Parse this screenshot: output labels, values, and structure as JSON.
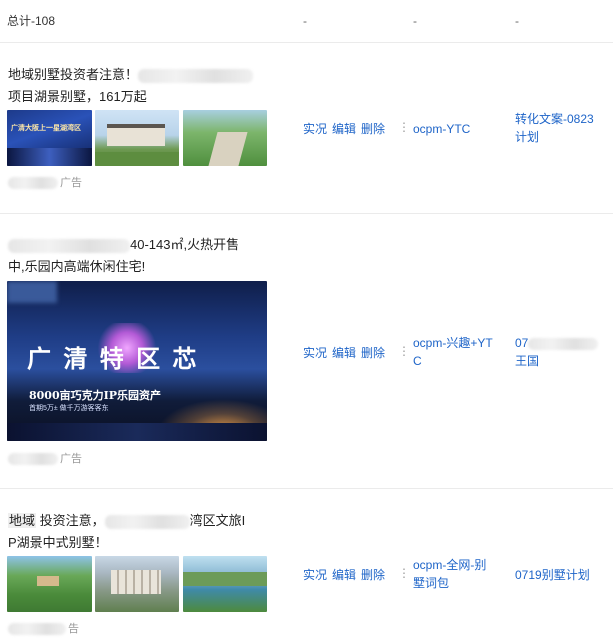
{
  "total": {
    "label": "总计-108",
    "col2": "-",
    "col3": "-",
    "col4": "-"
  },
  "ads": [
    {
      "title_a": "地域别墅投资者注意！",
      "title_b": "项目湖景别墅，161万起",
      "thumb1_text": "广清大阪上一星湖湾区",
      "meta_suffix": "广告",
      "actions": [
        "实况",
        "编辑",
        "删除"
      ],
      "more": "⋮",
      "bid": "ocpm-YTC",
      "plan": "转化文案-0823计划"
    },
    {
      "title_a": "40-143㎡,火热开售",
      "title_b": "中,乐园内高端休闲住宅!",
      "banner_main": "广 清 特 区 芯",
      "banner_sub": "8000亩巧克力IP乐园资产",
      "banner_small": "首期5万± 做千万游客客东",
      "meta_suffix": "广告",
      "actions": [
        "实况",
        "编辑",
        "删除"
      ],
      "more": "⋮",
      "bid": "ocpm-兴趣+YTC",
      "plan_a": "07",
      "plan_b": "王国"
    },
    {
      "title_a": "地域",
      "title_b": "投资注意，",
      "title_c": "湾区文旅I",
      "title_d": "P湖景中式别墅！",
      "meta_suffix": "告",
      "actions": [
        "实况",
        "编辑",
        "删除"
      ],
      "more": "⋮",
      "bid": "ocpm-全网-别墅词包",
      "plan": "0719别墅计划"
    }
  ]
}
